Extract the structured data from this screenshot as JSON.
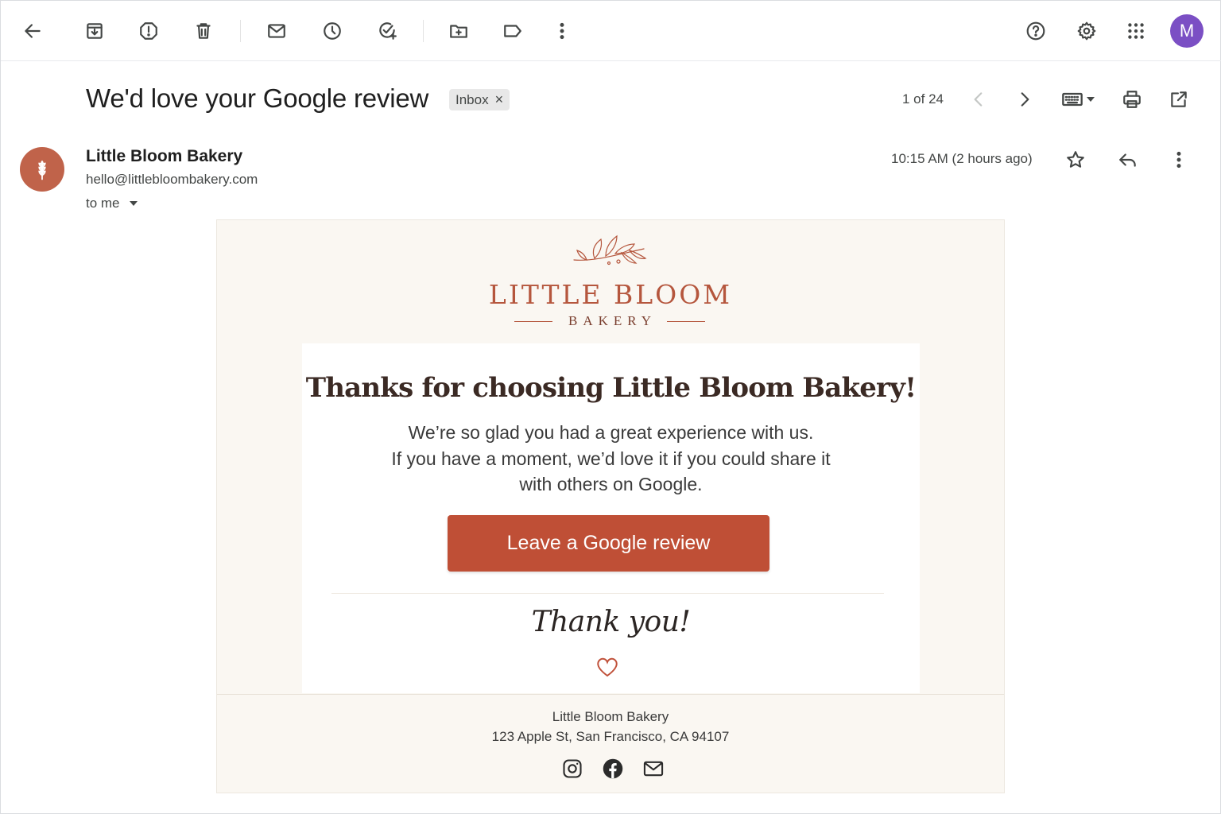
{
  "toolbar": {
    "back_icon": "arrow-left-icon",
    "archive_icon": "archive-icon",
    "spam_icon": "report-spam-icon",
    "delete_icon": "trash-icon",
    "mark_unread_icon": "envelope-icon",
    "snooze_icon": "clock-icon",
    "add_task_icon": "add-task-icon",
    "move_icon": "folder-move-icon",
    "label_icon": "label-icon",
    "more_icon": "more-vert-icon",
    "help_icon": "help-icon",
    "settings_icon": "gear-icon",
    "apps_icon": "apps-grid-icon",
    "account_initial": "M"
  },
  "message": {
    "subject": "We'd love your Google review",
    "label_chip": "Inbox",
    "chip_close": "×",
    "pager": "1 of 24",
    "sender_name": "Little Bloom Bakery",
    "sender_email": "hello@littlebloombakery.com",
    "recipient": "to me",
    "timestamp": "10:15 AM (2 hours ago)"
  },
  "email": {
    "brand_title": "LITTLE BLOOM",
    "brand_subtitle": "BAKERY",
    "headline": "Thanks for choosing Little Bloom Bakery!",
    "body_lines": [
      "We’re so glad you had a great experience with us.",
      "If you have a moment, we’d love it if you could share it",
      "with others on Google."
    ],
    "cta_label": "Leave a Google review",
    "signoff": "Thank you!",
    "footer_name": "Little Bloom Bakery",
    "footer_address": "123 Apple St, San Francisco, CA 94107",
    "social_icons": [
      "instagram-icon",
      "facebook-icon",
      "mail-icon"
    ]
  },
  "colors": {
    "brand": "#b5563d",
    "cta": "#bf4f36",
    "avatar_account": "#7b4fc4",
    "email_background": "#faf7f2"
  }
}
